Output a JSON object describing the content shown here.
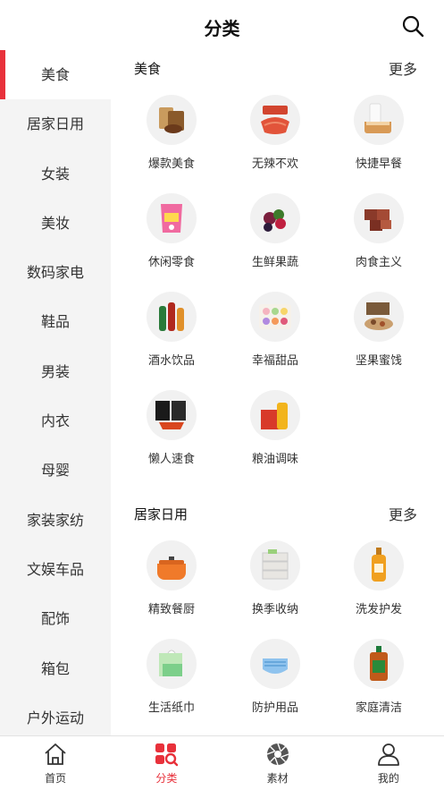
{
  "header": {
    "title": "分类",
    "search_icon": "search-icon"
  },
  "sidebar": {
    "active_color": "#e8313b",
    "items": [
      {
        "label": "美食",
        "active": true
      },
      {
        "label": "居家日用"
      },
      {
        "label": "女装"
      },
      {
        "label": "美妆"
      },
      {
        "label": "数码家电"
      },
      {
        "label": "鞋品"
      },
      {
        "label": "男装"
      },
      {
        "label": "内衣"
      },
      {
        "label": "母婴"
      },
      {
        "label": "家装家纺"
      },
      {
        "label": "文娱车品"
      },
      {
        "label": "配饰"
      },
      {
        "label": "箱包"
      },
      {
        "label": "户外运动"
      }
    ]
  },
  "sections": [
    {
      "title": "美食",
      "more": "更多",
      "items": [
        {
          "label": "爆款美食",
          "icon": "snack-box-icon"
        },
        {
          "label": "无辣不欢",
          "icon": "spicy-food-icon"
        },
        {
          "label": "快捷早餐",
          "icon": "bread-milk-icon"
        },
        {
          "label": "休闲零食",
          "icon": "snack-bag-icon"
        },
        {
          "label": "生鲜果蔬",
          "icon": "fruit-icon"
        },
        {
          "label": "肉食主义",
          "icon": "meat-icon"
        },
        {
          "label": "酒水饮品",
          "icon": "bottles-icon"
        },
        {
          "label": "幸福甜品",
          "icon": "macaron-icon"
        },
        {
          "label": "坚果蜜饯",
          "icon": "nuts-icon"
        },
        {
          "label": "懒人速食",
          "icon": "instant-noodle-icon"
        },
        {
          "label": "粮油调味",
          "icon": "oil-rice-icon"
        }
      ]
    },
    {
      "title": "居家日用",
      "more": "更多",
      "items": [
        {
          "label": "精致餐厨",
          "icon": "pot-icon"
        },
        {
          "label": "换季收纳",
          "icon": "storage-box-icon"
        },
        {
          "label": "洗发护发",
          "icon": "shampoo-icon"
        },
        {
          "label": "生活纸巾",
          "icon": "tissue-icon"
        },
        {
          "label": "防护用品",
          "icon": "mask-icon"
        },
        {
          "label": "家庭清洁",
          "icon": "disinfectant-icon"
        }
      ]
    }
  ],
  "tabbar": {
    "active_color": "#e8313b",
    "tabs": [
      {
        "label": "首页",
        "icon": "home-icon"
      },
      {
        "label": "分类",
        "icon": "category-icon",
        "active": true
      },
      {
        "label": "素材",
        "icon": "aperture-icon"
      },
      {
        "label": "我的",
        "icon": "profile-icon"
      }
    ]
  }
}
